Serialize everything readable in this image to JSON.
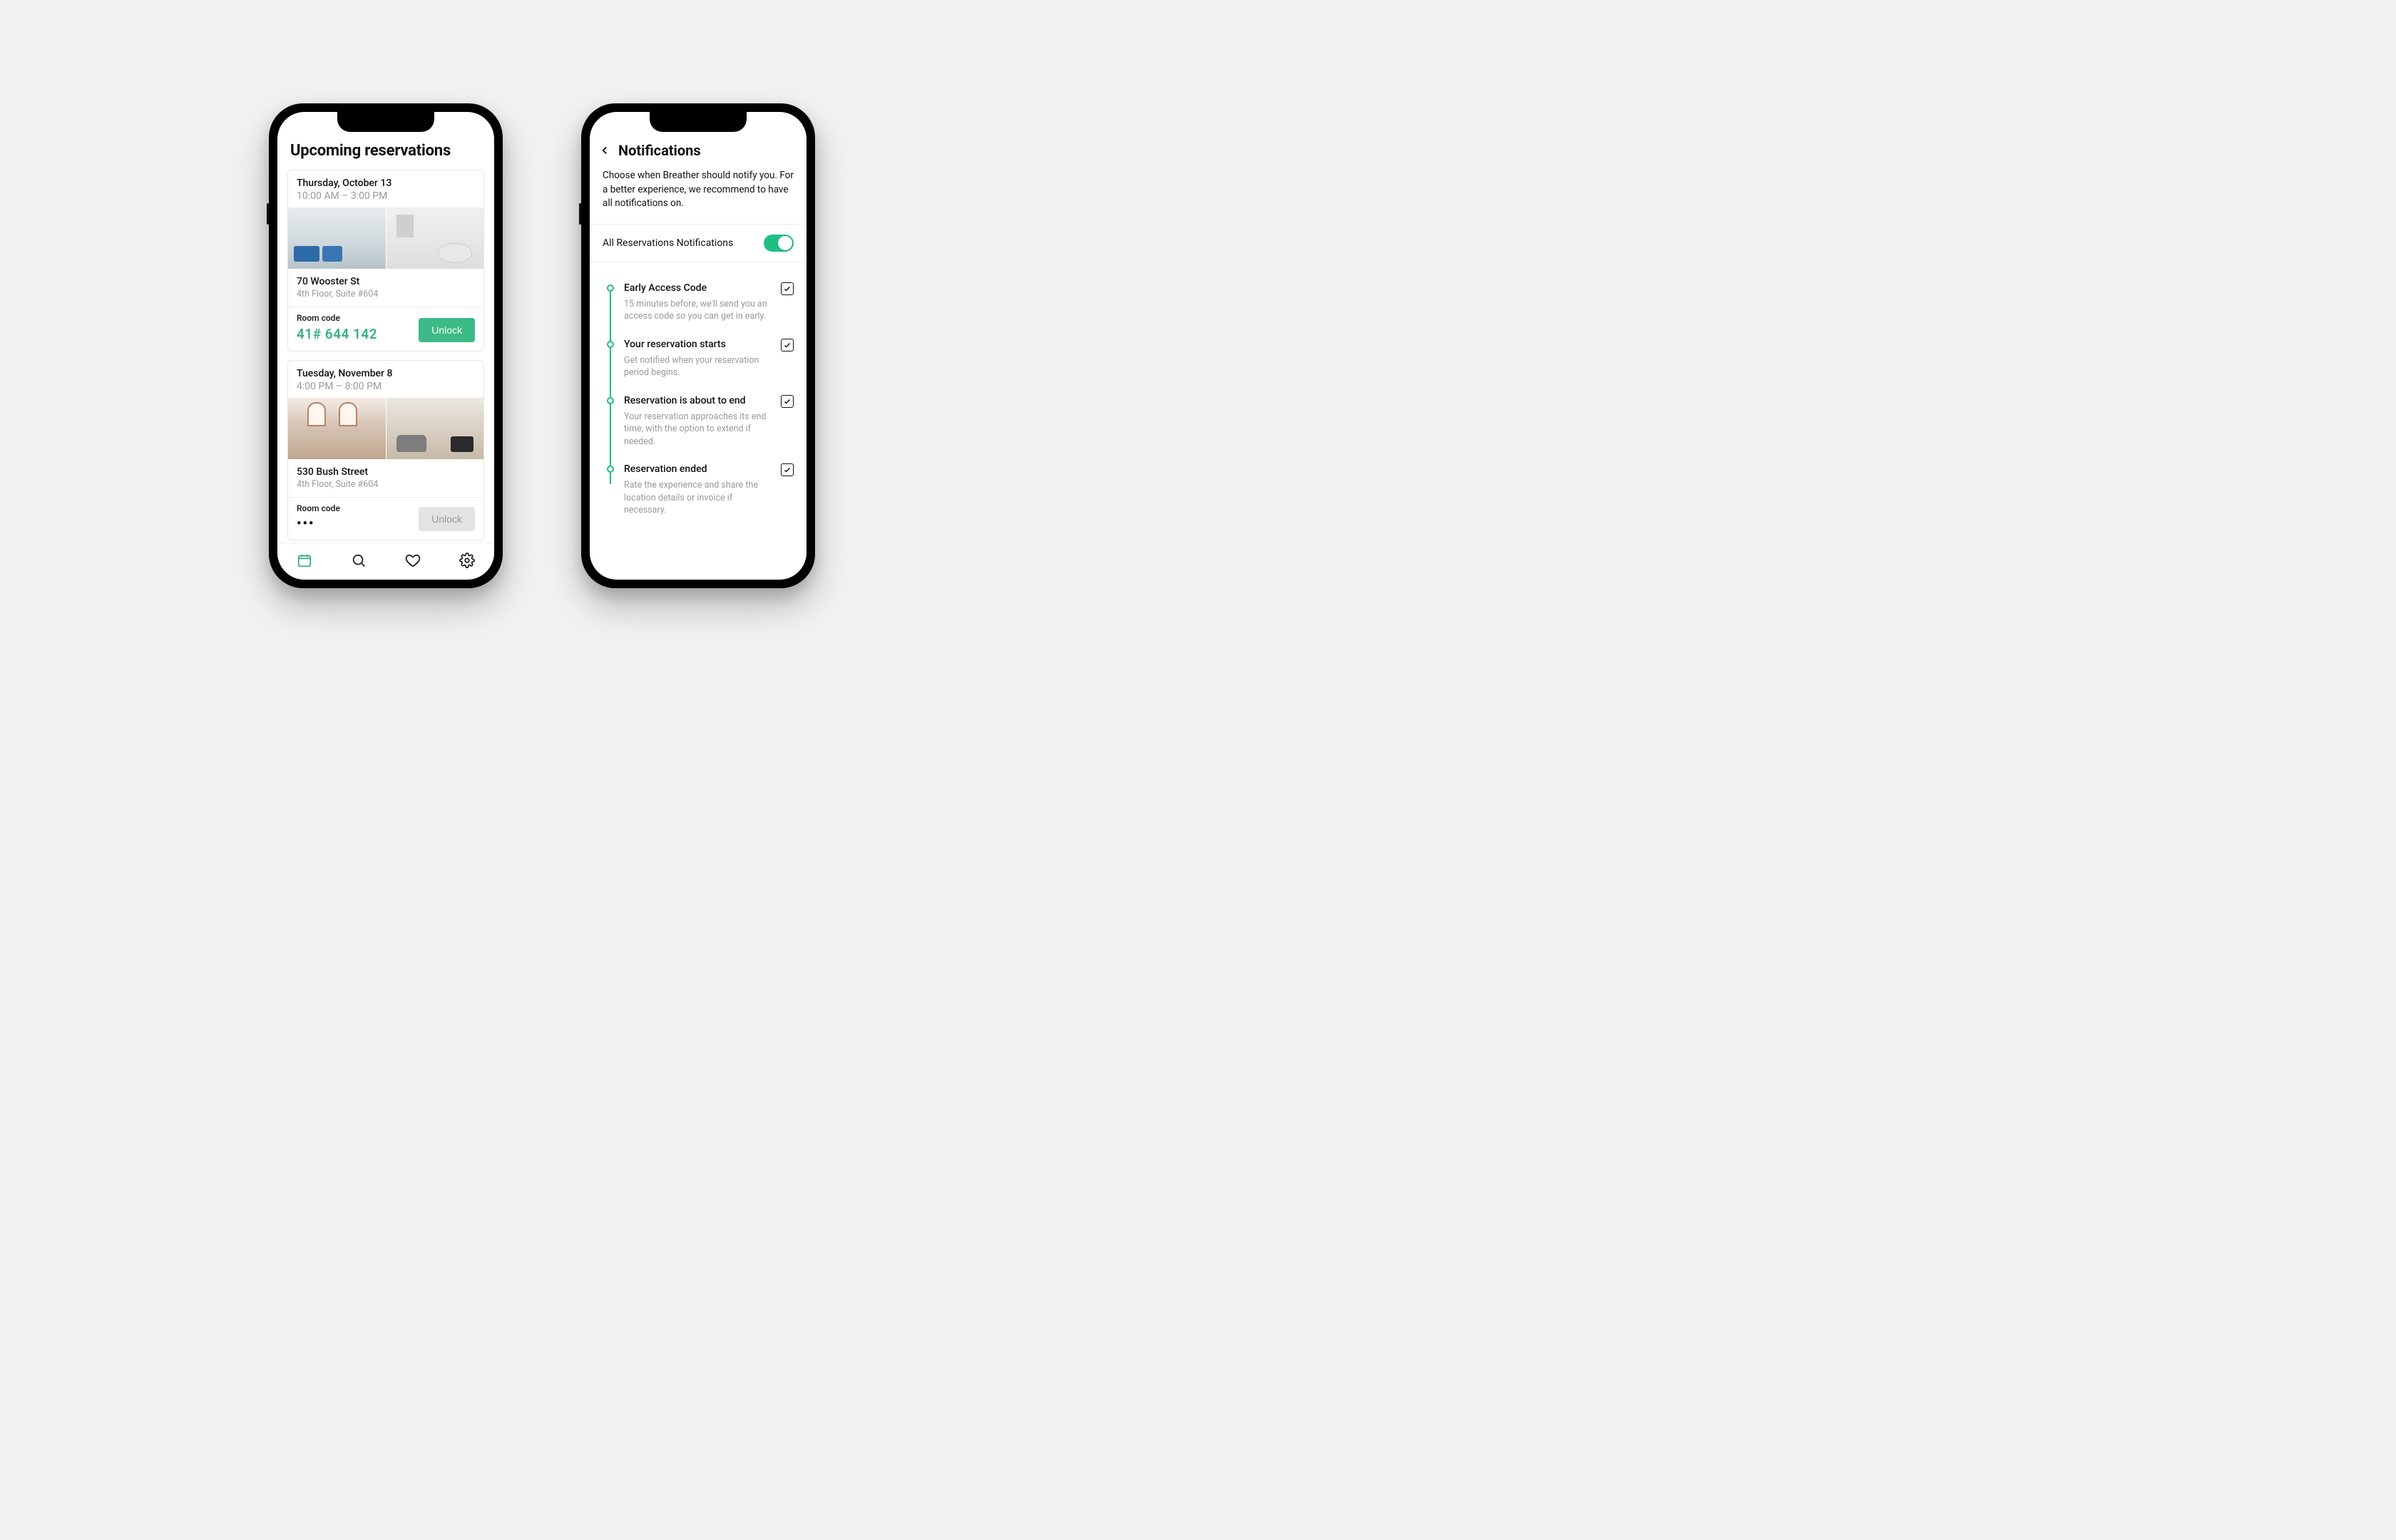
{
  "colors": {
    "accent": "#36b37e",
    "toggle": "#1fbf83"
  },
  "reservations_screen": {
    "title": "Upcoming reservations",
    "cards": [
      {
        "date": "Thursday, October 13",
        "time": "10:00 AM – 3:00 PM",
        "address": "70 Wooster St",
        "address_sub": "4th Floor, Suite #604",
        "room_code_label": "Room code",
        "room_code": "41# 644 142",
        "unlock_label": "Unlock",
        "unlock_enabled": true
      },
      {
        "date": "Tuesday, November 8",
        "time": "4:00 PM – 8:00 PM",
        "address": "530 Bush Street",
        "address_sub": "4th Floor, Suite #604",
        "room_code_label": "Room code",
        "room_code": "•••",
        "unlock_label": "Unlock",
        "unlock_enabled": false
      }
    ],
    "tabbar": {
      "items": [
        "calendar",
        "search",
        "favorites",
        "settings"
      ],
      "active_index": 0
    }
  },
  "notifications_screen": {
    "title": "Notifications",
    "intro": "Choose when Breather should notify you. For a better experience, we recommend to have all notifications on.",
    "master_toggle_label": "All Reservations Notifications",
    "master_toggle_on": true,
    "timeline": [
      {
        "title": "Early Access Code",
        "desc": "15 minutes before, we'll send you an access code so you can get in early.",
        "checked": true
      },
      {
        "title": "Your reservation starts",
        "desc": "Get notified when your reservation period begins.",
        "checked": true
      },
      {
        "title": "Reservation is about to end",
        "desc": "Your reservation approaches its end time, with the option to extend if needed.",
        "checked": true
      },
      {
        "title": "Reservation ended",
        "desc": "Rate the experience and share the location details or invoice if necessary.",
        "checked": true
      }
    ]
  }
}
